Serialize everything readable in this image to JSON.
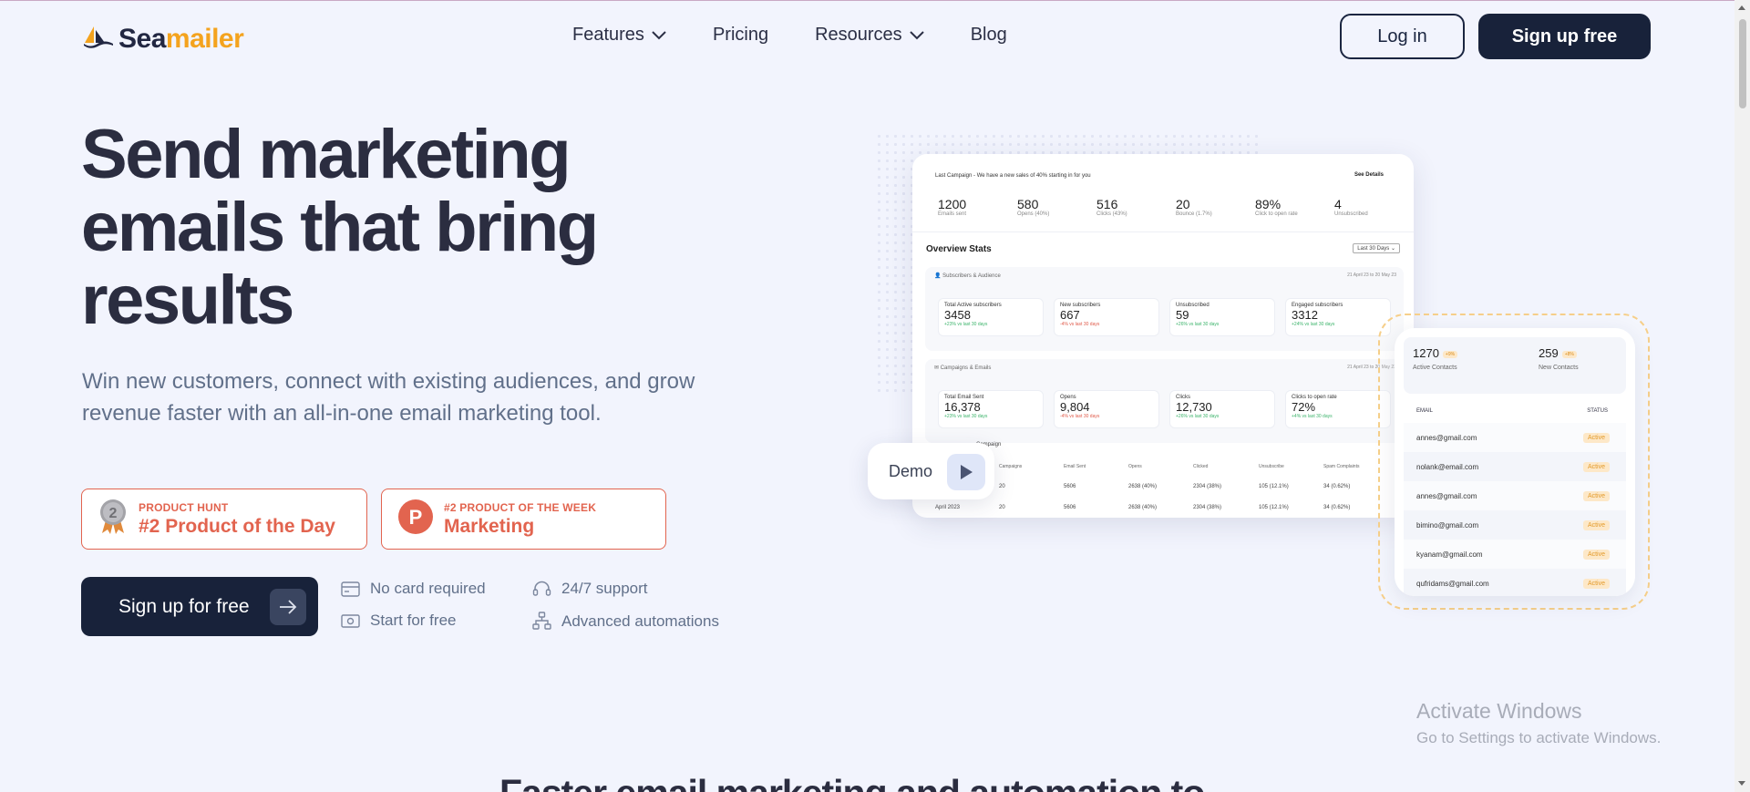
{
  "brand": {
    "name_part1": "Sea",
    "name_part2": "mailer"
  },
  "nav": {
    "features": "Features",
    "pricing": "Pricing",
    "resources": "Resources",
    "blog": "Blog",
    "login": "Log in",
    "signup": "Sign up free"
  },
  "hero": {
    "title": "Send marketing emails that bring results",
    "subtitle": "Win new customers, connect with existing audiences, and grow revenue faster with an all-in-one email marketing tool.",
    "badges": [
      {
        "eyebrow": "PRODUCT HUNT",
        "title": "#2 Product of the Day",
        "medal": "2"
      },
      {
        "eyebrow": "#2 PRODUCT OF THE WEEK",
        "title": "Marketing",
        "logo": "P"
      }
    ],
    "cta": "Sign up for free",
    "features": [
      "No card required",
      "24/7 support",
      "Start for free",
      "Advanced automations"
    ]
  },
  "dashboard": {
    "last_campaign": "Last Campaign - We have a new sales of 40% starting in for you",
    "see_details": "See Details",
    "kpis": [
      {
        "value": "1200",
        "label": "Emails sent"
      },
      {
        "value": "580",
        "label": "Opens (40%)"
      },
      {
        "value": "516",
        "label": "Clicks (43%)"
      },
      {
        "value": "20",
        "label": "Bounce (1.7%)"
      },
      {
        "value": "89%",
        "label": "Click to open rate"
      },
      {
        "value": "4",
        "label": "Unsubscribed"
      }
    ],
    "overview_title": "Overview Stats",
    "range_select": "Last 30 Days",
    "subs_section": "Subscribers & Audience",
    "subs_dates": "21 April 23 to 20 May 23",
    "subs_cards": [
      {
        "label": "Total Active subscribers",
        "value": "3458",
        "delta": "+23% vs last 30 days",
        "trend": "up"
      },
      {
        "label": "New subscribers",
        "value": "667",
        "delta": "-4% vs last 30 days",
        "trend": "down"
      },
      {
        "label": "Unsubscribed",
        "value": "59",
        "delta": "+26% vs last 30 days",
        "trend": "up"
      },
      {
        "label": "Engaged subscribers",
        "value": "3312",
        "delta": "+24% vs last 30 days",
        "trend": "up"
      }
    ],
    "camp_section": "Campaigns & Emails",
    "camp_dates": "21 April 23 to 20 May 23",
    "camp_cards": [
      {
        "label": "Total Email Sent",
        "value": "16,378",
        "delta": "+23% vs last 30 days",
        "trend": "up"
      },
      {
        "label": "Opens",
        "value": "9,804",
        "delta": "-4% vs last 30 days",
        "trend": "down"
      },
      {
        "label": "Clicks",
        "value": "12,730",
        "delta": "+26% vs last 30 days",
        "trend": "up"
      },
      {
        "label": "Clicks to open rate",
        "value": "72%",
        "delta": "+4% vs last 30 days",
        "trend": "up"
      }
    ],
    "table_caption": "Campaign",
    "table_headers": [
      "",
      "Campaigns",
      "Email Sent",
      "Opens",
      "Clicked",
      "Unsubscribe",
      "Spam Complaints"
    ],
    "table_rows": [
      [
        "",
        "20",
        "5606",
        "2638 (40%)",
        "2304 (38%)",
        "105 (12.1%)",
        "34 (0.62%)"
      ],
      [
        "April 2023",
        "20",
        "5606",
        "2638 (40%)",
        "2304 (38%)",
        "105 (12.1%)",
        "34 (0.62%)"
      ]
    ]
  },
  "demo": {
    "label": "Demo"
  },
  "contacts": {
    "active_value": "1270",
    "active_badge": "+9%",
    "active_label": "Active Contacts",
    "new_value": "259",
    "new_badge": "+8%",
    "new_label": "New Contacts",
    "col_email": "EMAIL",
    "col_status": "STATUS",
    "rows": [
      {
        "email": "annes@gmail.com",
        "status": "Active"
      },
      {
        "email": "nolank@email.com",
        "status": "Active"
      },
      {
        "email": "annes@gmail.com",
        "status": "Active"
      },
      {
        "email": "bimino@gmail.com",
        "status": "Active"
      },
      {
        "email": "kyanam@gmail.com",
        "status": "Active"
      },
      {
        "email": "qufridams@gmail.com",
        "status": "Active"
      }
    ]
  },
  "watermark": {
    "line1": "Activate Windows",
    "line2": "Go to Settings to activate Windows."
  },
  "next_section_heading": "Faster email marketing and automation to"
}
